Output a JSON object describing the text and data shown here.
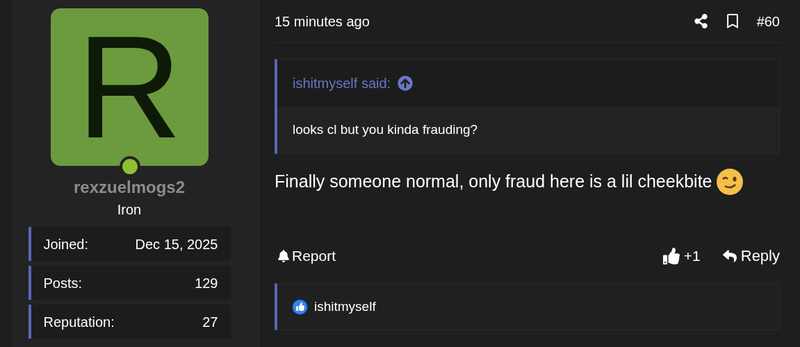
{
  "author": {
    "avatar_letter": "R",
    "online": true,
    "username": "rexzuelmogs2",
    "rank": "Iron",
    "stats": [
      {
        "label": "Joined:",
        "value": "Dec 15, 2025"
      },
      {
        "label": "Posts:",
        "value": "129"
      },
      {
        "label": "Reputation:",
        "value": "27"
      }
    ]
  },
  "post": {
    "time": "15 minutes ago",
    "number": "#60",
    "quote": {
      "author": "ishitmyself said:",
      "text": "looks cl but you kinda frauding?"
    },
    "message": "Finally someone normal, only fraud here is a lil cheekbite",
    "report": "Report",
    "like_count": "+1",
    "reply": "Reply",
    "reactions": {
      "users": "ishitmyself"
    }
  }
}
